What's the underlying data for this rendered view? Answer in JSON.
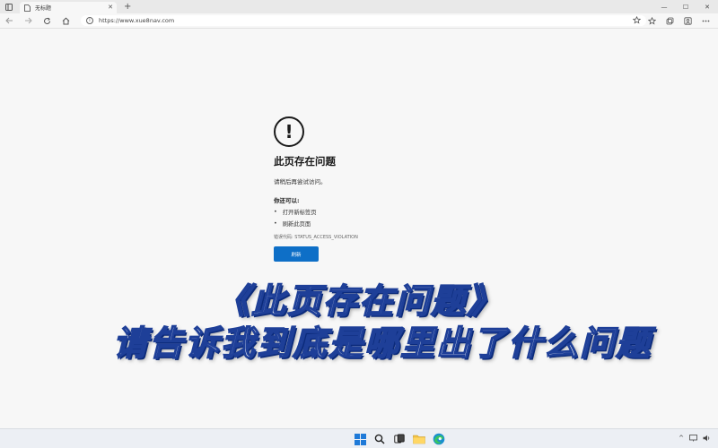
{
  "browser": {
    "tab": {
      "title": "无标题",
      "favicon": "page-icon",
      "close_label": "✕"
    },
    "new_tab_label": "+",
    "window_controls": {
      "minimize": "—",
      "maximize": "☐",
      "close": "✕"
    },
    "address": {
      "url": "https://www.xue8nav.com"
    }
  },
  "error_page": {
    "title": "此页存在问题",
    "description": "请稍后再尝试访问。",
    "suggestions_title": "你还可以:",
    "suggestions": [
      "打开新标签页",
      "刷新此页面"
    ],
    "error_code": "错误代码: STATUS_ACCESS_VIOLATION",
    "refresh_button": "刷新"
  },
  "overlay_caption": {
    "line1": "《此页存在问题》",
    "line2": "请告诉我到底是哪里出了什么问题"
  },
  "taskbar": {
    "icons": [
      "windows-start-icon",
      "search-icon",
      "task-view-icon",
      "file-explorer-icon",
      "edge-browser-icon"
    ],
    "tray": {
      "chevron": "^"
    }
  },
  "colors": {
    "button_blue": "#0e6fc7",
    "caption_outline": "#1e3f98",
    "page_bg": "#f7f7f7"
  }
}
